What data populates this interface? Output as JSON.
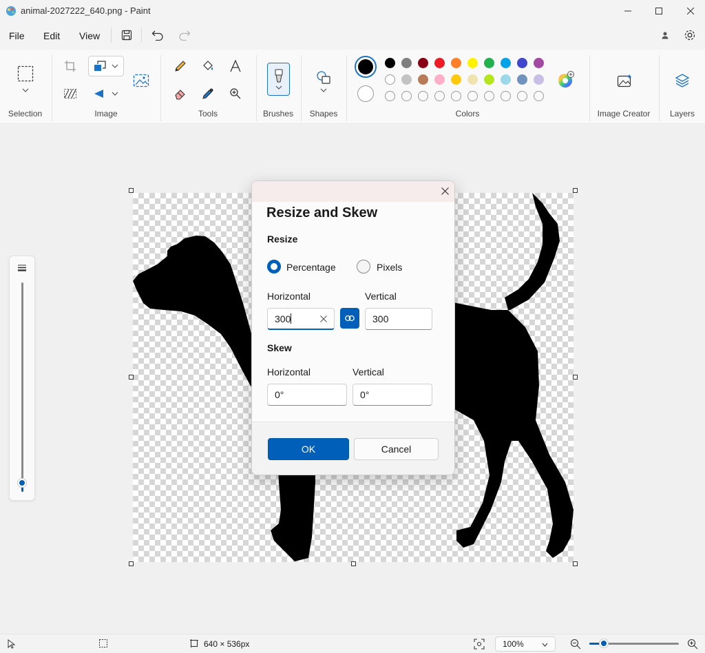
{
  "window": {
    "title": "animal-2027222_640.png - Paint"
  },
  "menu": {
    "file": "File",
    "edit": "Edit",
    "view": "View"
  },
  "ribbon": {
    "groups": {
      "selection": "Selection",
      "image": "Image",
      "tools": "Tools",
      "brushes": "Brushes",
      "shapes": "Shapes",
      "colors": "Colors",
      "image_creator": "Image Creator",
      "layers": "Layers"
    },
    "colors": {
      "primary": "#000000",
      "secondary": "#ffffff",
      "row1": [
        "#000000",
        "#7f7f7f",
        "#880015",
        "#ed1c24",
        "#ff7f27",
        "#fff200",
        "#22b14c",
        "#00a2e8",
        "#3f48cc",
        "#a349a4"
      ],
      "row2": [
        "#ffffff",
        "#c3c3c3",
        "#b97a57",
        "#ffaec9",
        "#ffc90e",
        "#efe4b0",
        "#b5e61d",
        "#99d9ea",
        "#7092be",
        "#c8bfe7"
      ],
      "row3_empty_count": 10
    }
  },
  "dialog": {
    "title": "Resize and Skew",
    "resize": {
      "heading": "Resize",
      "option_percentage": "Percentage",
      "option_pixels": "Pixels",
      "selected": "Percentage",
      "horizontal_label": "Horizontal",
      "vertical_label": "Vertical",
      "horizontal_value": "300",
      "vertical_value": "300",
      "lock_aspect": true
    },
    "skew": {
      "heading": "Skew",
      "horizontal_label": "Horizontal",
      "vertical_label": "Vertical",
      "horizontal_value": "0°",
      "vertical_value": "0°"
    },
    "ok_label": "OK",
    "cancel_label": "Cancel"
  },
  "status": {
    "image_size": "640 × 536px",
    "zoom": "100%"
  },
  "accent_color": "#005fb8"
}
